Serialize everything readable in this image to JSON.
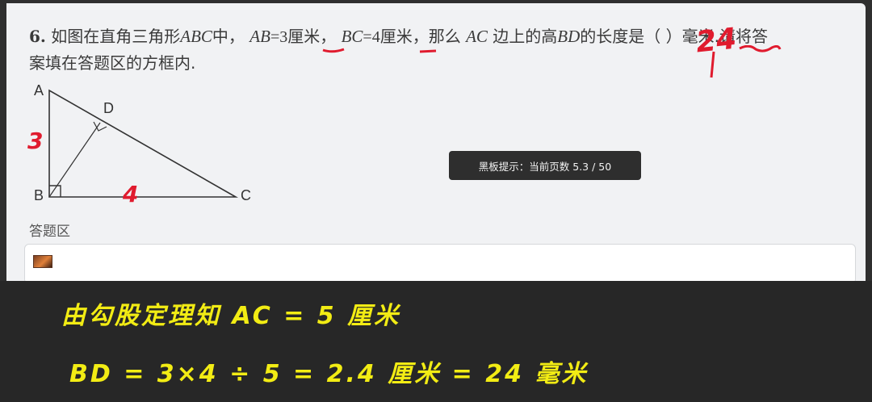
{
  "question": {
    "number": "6.",
    "text_1": "如图在直角三角形",
    "var_abc": "ABC",
    "text_2": "中，",
    "var_ab": "AB",
    "eq_ab": "=3",
    "unit_1": "厘米",
    "comma": "，",
    "var_bc": "BC",
    "eq_bc": "=4",
    "unit_2": "厘米",
    "text_3": "，那么",
    "var_ac": "AC",
    "text_4": "边上的高",
    "var_bd": "BD",
    "text_5": "的长度是（  ）",
    "unit_3": "毫米",
    "text_6": ".请将答",
    "line_2": "案填在答题区的方框内."
  },
  "figure": {
    "label_a": "A",
    "label_b": "B",
    "label_c": "C",
    "label_d": "D"
  },
  "annotations": {
    "answer": "24",
    "side_ab": "3",
    "side_bc": "4"
  },
  "answer_area": {
    "label": "答题区"
  },
  "toast": {
    "text": "黑板提示：当前页数 5.3 / 50"
  },
  "blackboard": {
    "line_1": "由勾股定理知  AC = 5 厘米",
    "line_2": "BD = 3×4 ÷ 5 = 2.4 厘米 = 24 毫米"
  },
  "colors": {
    "ink_red": "#e01b2e",
    "chalk_yellow": "#f2ec14",
    "board_bg": "#272727"
  }
}
